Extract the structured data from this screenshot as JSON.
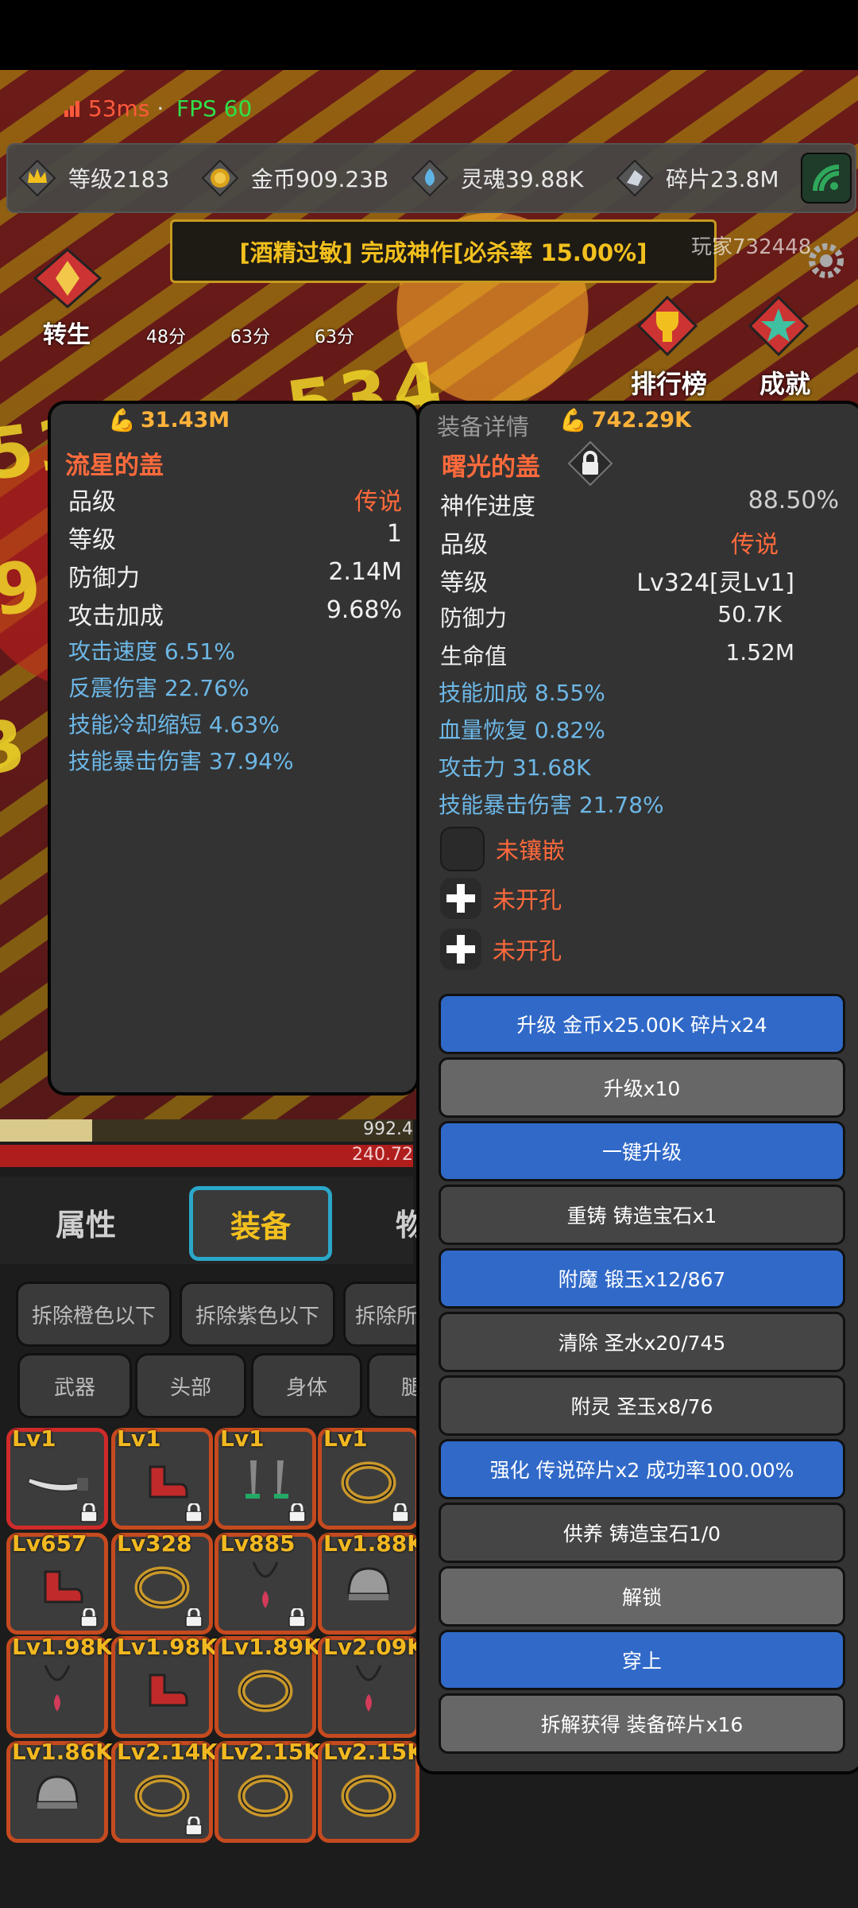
{
  "status": {
    "ping": "53ms",
    "separator": "·",
    "fps": "FPS 60"
  },
  "resources": [
    {
      "icon": "crown-icon",
      "label": "等级2183"
    },
    {
      "icon": "coin-icon",
      "label": "金币909.23B"
    },
    {
      "icon": "soul-icon",
      "label": "灵魂39.88K"
    },
    {
      "icon": "fragment-icon",
      "label": "碎片23.8M"
    }
  ],
  "notice": "[酒精过敏] 完成神作[必杀率 15.00%]",
  "battle": {
    "player_tag": "玩家732448",
    "rebirth": "转生",
    "ranking": "排行榜",
    "achievements": "成就",
    "timers": [
      "48分",
      "63分",
      "63分"
    ],
    "exp_value": "992.4",
    "hp_value": "240.72"
  },
  "left_panel": {
    "power": "31.43M",
    "name": "流星的盖",
    "stats": [
      {
        "label": "品级",
        "value": "传说",
        "accent": true
      },
      {
        "label": "等级",
        "value": "1"
      },
      {
        "label": "防御力",
        "value": "2.14M"
      },
      {
        "label": "攻击加成",
        "value": "9.68%"
      }
    ],
    "affixes": [
      "攻击速度 6.51%",
      "反震伤害 22.76%",
      "技能冷却缩短 4.63%",
      "技能暴击伤害 37.94%"
    ]
  },
  "right_panel": {
    "header": "装备详情",
    "power": "742.29K",
    "name": "曙光的盖",
    "stats": [
      {
        "label": "神作进度",
        "value": "88.50%"
      },
      {
        "label": "品级",
        "value": "传说",
        "accent": true
      },
      {
        "label": "等级",
        "value": "Lv324[灵Lv1]"
      },
      {
        "label": "防御力",
        "value": "50.7K"
      },
      {
        "label": "生命值",
        "value": "1.52M"
      }
    ],
    "affixes": [
      "技能加成 8.55%",
      "血量恢复 0.82%",
      "攻击力 31.68K",
      "技能暴击伤害 21.78%"
    ],
    "sockets": [
      "未镶嵌",
      "未开孔",
      "未开孔"
    ],
    "buttons": [
      {
        "label": "升级 金币x25.00K 碎片x24",
        "style": "blue"
      },
      {
        "label": "升级x10",
        "style": "gray"
      },
      {
        "label": "一键升级",
        "style": "blue"
      },
      {
        "label": "重铸 铸造宝石x1",
        "style": "dark"
      },
      {
        "label": "附魔 锻玉x12/867",
        "style": "blue"
      },
      {
        "label": "清除 圣水x20/745",
        "style": "dark"
      },
      {
        "label": "附灵 圣玉x8/76",
        "style": "dark"
      },
      {
        "label": "强化 传说碎片x2 成功率100.00%",
        "style": "blue"
      },
      {
        "label": "供养 铸造宝石1/0",
        "style": "dark"
      },
      {
        "label": "解锁",
        "style": "gray"
      },
      {
        "label": "穿上",
        "style": "blue"
      },
      {
        "label": "拆解获得 装备碎片x16",
        "style": "gray"
      }
    ]
  },
  "tabs": {
    "attributes": "属性",
    "equipment": "装备",
    "items_partial": "物"
  },
  "filters": [
    "拆除橙色以下",
    "拆除紫色以下",
    "拆除所"
  ],
  "categories": [
    "武器",
    "头部",
    "身体",
    "腿"
  ],
  "inventory": [
    {
      "level": "Lv1",
      "item": "sword-icon",
      "locked": true
    },
    {
      "level": "Lv1",
      "item": "boot-icon",
      "locked": true
    },
    {
      "level": "Lv1",
      "item": "daggers-icon",
      "locked": true
    },
    {
      "level": "Lv1",
      "item": "ring-icon",
      "locked": true
    },
    {
      "level": "Lv657",
      "item": "boot-icon",
      "locked": true
    },
    {
      "level": "Lv328",
      "item": "ring-icon",
      "locked": true
    },
    {
      "level": "Lv885",
      "item": "amulet-icon",
      "locked": true
    },
    {
      "level": "Lv1.88K",
      "item": "helmet-icon",
      "locked": false
    },
    {
      "level": "Lv1.98K",
      "item": "amulet-icon",
      "locked": false
    },
    {
      "level": "Lv1.98K",
      "item": "boot-icon",
      "locked": false
    },
    {
      "level": "Lv1.89K",
      "item": "ring-icon",
      "locked": false
    },
    {
      "level": "Lv2.09K",
      "item": "amulet-icon",
      "locked": false
    },
    {
      "level": "Lv1.86K",
      "item": "helmet-icon",
      "locked": false
    },
    {
      "level": "Lv2.14K",
      "item": "ring-icon",
      "locked": true
    },
    {
      "level": "Lv2.15K",
      "item": "ring-icon",
      "locked": false
    },
    {
      "level": "Lv2.15K",
      "item": "ring-icon",
      "locked": false
    },
    {
      "level": "",
      "item": "amulet-icon",
      "locked": false
    }
  ]
}
